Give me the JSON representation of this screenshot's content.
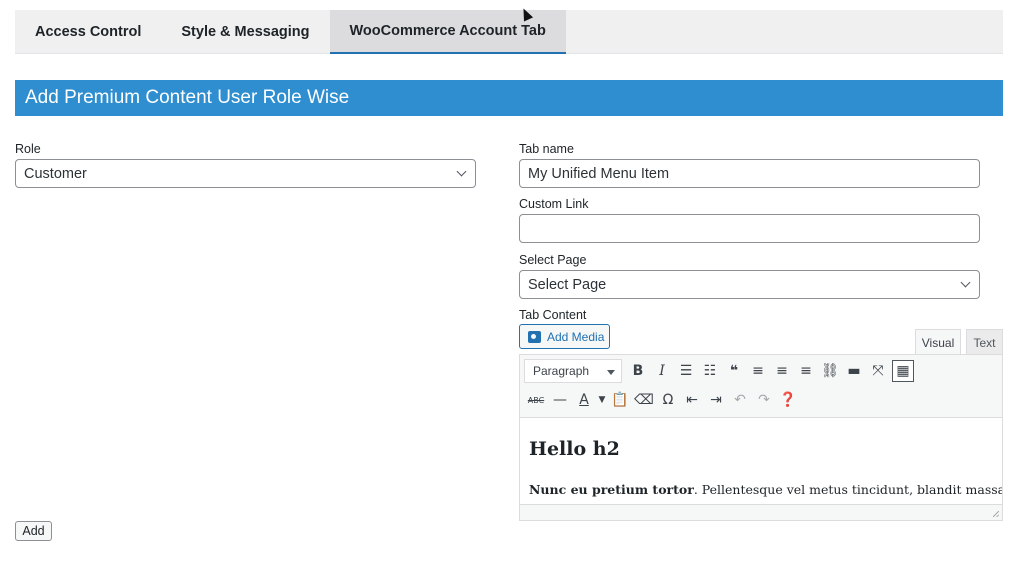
{
  "tabs": [
    {
      "label": "Access Control"
    },
    {
      "label": "Style & Messaging"
    },
    {
      "label": "WooCommerce Account Tab"
    }
  ],
  "section": {
    "title": "Add Premium Content User Role Wise"
  },
  "role": {
    "label": "Role",
    "value": "Customer"
  },
  "tab_name": {
    "label": "Tab name",
    "value": "My Unified Menu Item"
  },
  "custom_link": {
    "label": "Custom Link",
    "value": ""
  },
  "select_page": {
    "label": "Select Page",
    "value": "Select Page"
  },
  "tab_content": {
    "label": "Tab Content",
    "add_media": "Add Media",
    "visual_tab": "Visual",
    "text_tab": "Text",
    "format_select": "Paragraph",
    "heading": "Hello h2",
    "para_bold": "Nunc eu pretium tortor",
    "para_rest": ". Pellentesque vel metus tincidunt, blandit massa"
  },
  "add_button": "Add",
  "colors": {
    "accent": "#2e8ecf",
    "tab_active_underline": "#2271b1"
  }
}
